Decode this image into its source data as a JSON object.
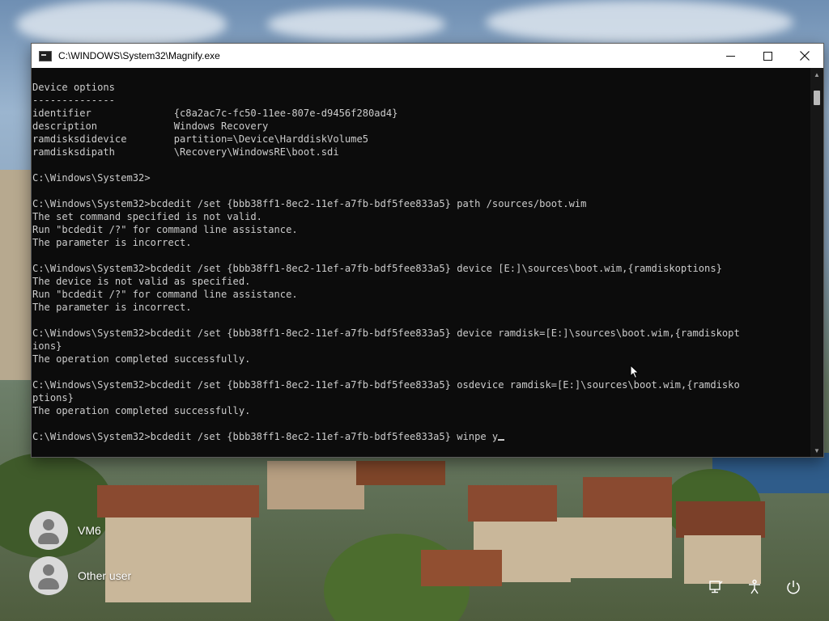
{
  "window": {
    "title": "C:\\WINDOWS\\System32\\Magnify.exe",
    "controls": {
      "minimize": "—",
      "maximize": "☐",
      "close": "✕"
    }
  },
  "console": {
    "lines": [
      "Device options",
      "--------------",
      "identifier              {c8a2ac7c-fc50-11ee-807e-d9456f280ad4}",
      "description             Windows Recovery",
      "ramdisksdidevice        partition=\\Device\\HarddiskVolume5",
      "ramdisksdipath          \\Recovery\\WindowsRE\\boot.sdi",
      "",
      "C:\\Windows\\System32>",
      "",
      "C:\\Windows\\System32>bcdedit /set {bbb38ff1-8ec2-11ef-a7fb-bdf5fee833a5} path /sources/boot.wim",
      "The set command specified is not valid.",
      "Run \"bcdedit /?\" for command line assistance.",
      "The parameter is incorrect.",
      "",
      "C:\\Windows\\System32>bcdedit /set {bbb38ff1-8ec2-11ef-a7fb-bdf5fee833a5} device [E:]\\sources\\boot.wim,{ramdiskoptions}",
      "The device is not valid as specified.",
      "Run \"bcdedit /?\" for command line assistance.",
      "The parameter is incorrect.",
      "",
      "C:\\Windows\\System32>bcdedit /set {bbb38ff1-8ec2-11ef-a7fb-bdf5fee833a5} device ramdisk=[E:]\\sources\\boot.wim,{ramdiskopt",
      "ions}",
      "The operation completed successfully.",
      "",
      "C:\\Windows\\System32>bcdedit /set {bbb38ff1-8ec2-11ef-a7fb-bdf5fee833a5} osdevice ramdisk=[E:]\\sources\\boot.wim,{ramdisko",
      "ptions}",
      "The operation completed successfully.",
      "",
      "C:\\Windows\\System32>bcdedit /set {bbb38ff1-8ec2-11ef-a7fb-bdf5fee833a5} winpe y"
    ]
  },
  "lock_screen": {
    "users": [
      {
        "name": "VM6"
      },
      {
        "name": "Other user"
      }
    ],
    "tray_icons": [
      "network-icon",
      "accessibility-icon",
      "power-icon"
    ]
  },
  "colors": {
    "console_bg": "#0c0c0c",
    "console_text": "#cccccc",
    "titlebar_bg": "#ffffff"
  }
}
